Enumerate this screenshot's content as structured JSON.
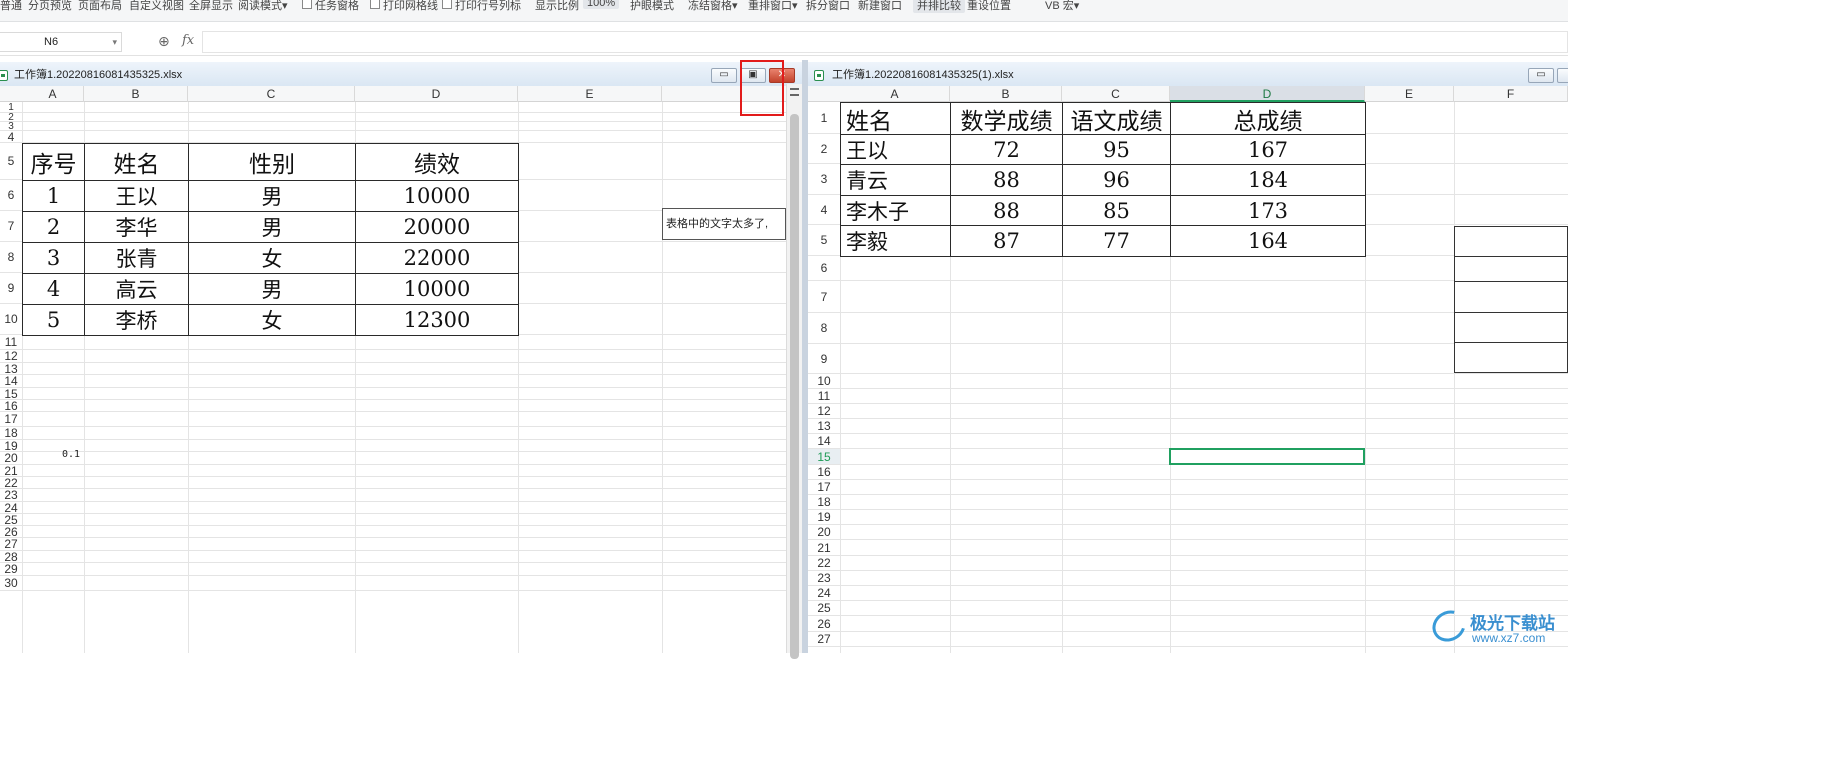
{
  "ribbon": {
    "items": [
      "普通",
      "分页预览",
      "页面布局",
      "自定义视图",
      "全屏显示",
      "阅读模式▾",
      "任务窗格",
      "打印网格线",
      "打印行号列标",
      "显示比例",
      "100%",
      "护眼模式",
      "冻结窗格▾",
      "重排窗口▾",
      "拆分窗口",
      "新建窗口",
      "并排比较",
      "重设位置",
      "VB 宏▾"
    ]
  },
  "formula_bar": {
    "cell_ref": "N6",
    "fx_label": "fx",
    "content": ""
  },
  "left_window": {
    "title": "工作簿1.20220816081435325.xlsx",
    "buttons": {
      "minimize": "▭",
      "restore": "▣",
      "close": "✕"
    },
    "columns": [
      "A",
      "B",
      "C",
      "D",
      "E"
    ],
    "rows": [
      "1",
      "2",
      "3",
      "4",
      "5",
      "6",
      "7",
      "8",
      "9",
      "10",
      "11",
      "12",
      "13",
      "14",
      "15",
      "16",
      "17",
      "18",
      "19",
      "20",
      "21",
      "22",
      "23",
      "24",
      "25",
      "26",
      "27",
      "28",
      "29",
      "30"
    ],
    "table": {
      "header": [
        "序号",
        "姓名",
        "性别",
        "绩效"
      ],
      "body": [
        [
          "1",
          "王以",
          "男",
          "10000"
        ],
        [
          "2",
          "李华",
          "男",
          "20000"
        ],
        [
          "3",
          "张青",
          "女",
          "22000"
        ],
        [
          "4",
          "高云",
          "男",
          "10000"
        ],
        [
          "5",
          "李桥",
          "女",
          "12300"
        ]
      ]
    },
    "overflow_text": "表格中的文字太多了,",
    "cell_a18": "0.1"
  },
  "right_window": {
    "title": "工作簿1.20220816081435325(1).xlsx",
    "buttons": {
      "minimize": "▭"
    },
    "columns": [
      "A",
      "B",
      "C",
      "D",
      "E",
      "F"
    ],
    "selected_column": "D",
    "rows": [
      "1",
      "2",
      "3",
      "4",
      "5",
      "6",
      "7",
      "8",
      "9",
      "10",
      "11",
      "12",
      "13",
      "14",
      "15",
      "16",
      "17",
      "18",
      "19",
      "20",
      "21",
      "22",
      "23",
      "24",
      "25",
      "26",
      "27"
    ],
    "selected_row": "15",
    "table": {
      "header": [
        "姓名",
        "数学成绩",
        "语文成绩",
        "总成绩"
      ],
      "body": [
        [
          "王以",
          "72",
          "95",
          "167"
        ],
        [
          "青云",
          "88",
          "96",
          "184"
        ],
        [
          "李木子",
          "88",
          "85",
          "173"
        ],
        [
          "李毅",
          "87",
          "77",
          "164"
        ]
      ]
    }
  },
  "watermark": {
    "line1": "极光下载站",
    "line2": "www.xz7.com"
  },
  "colors": {
    "selection": "#20a060",
    "highlight_box": "#e21b1b",
    "title_bar": "#d9e6f3"
  }
}
